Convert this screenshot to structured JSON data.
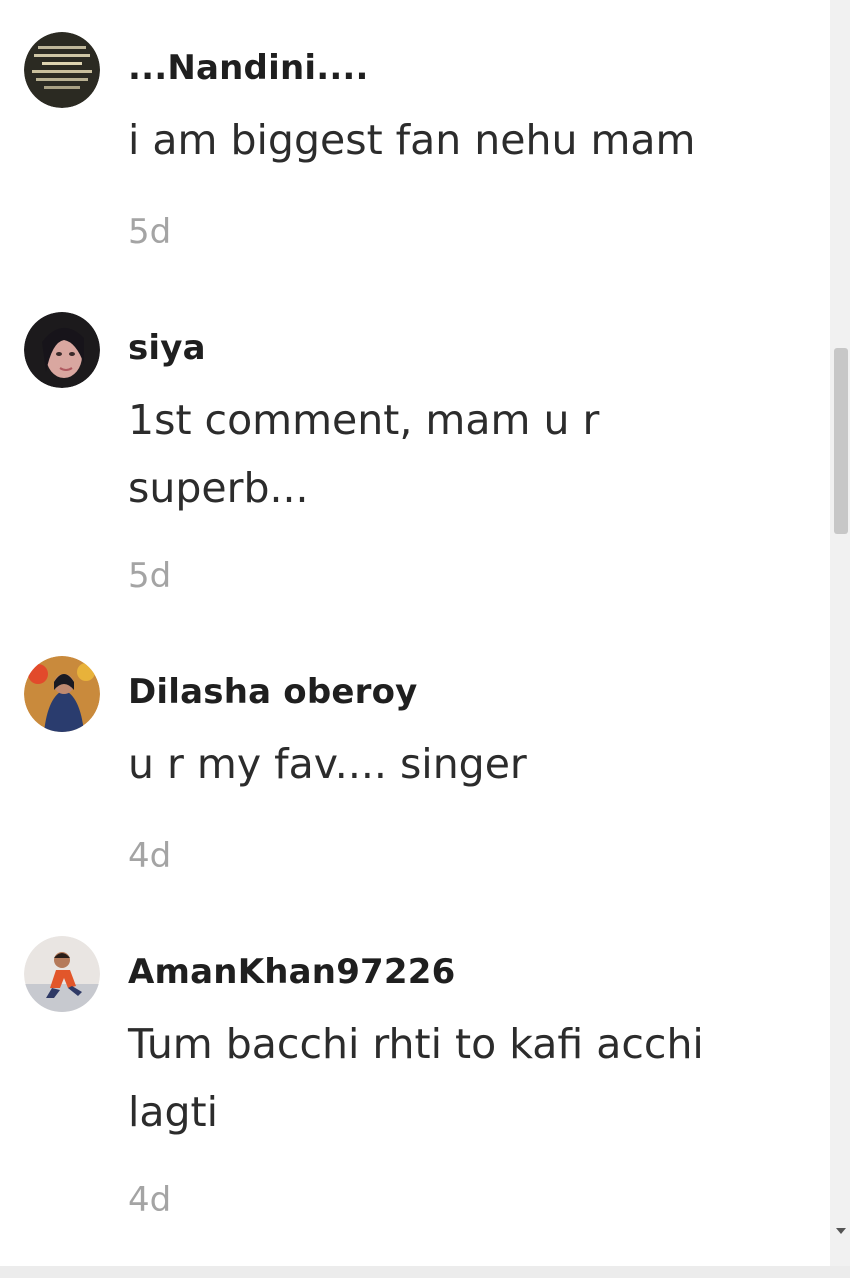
{
  "comments": [
    {
      "username": "...Nandini....",
      "text": "i am biggest fan nehu mam",
      "time": "5d",
      "avatar": "avatar-nandini"
    },
    {
      "username": "siya",
      "text": "1st comment, mam u r superb...",
      "time": "5d",
      "avatar": "avatar-siya"
    },
    {
      "username": "Dilasha oberoy",
      "text": "u r my fav.... singer",
      "time": "4d",
      "avatar": "avatar-dilasha"
    },
    {
      "username": "AmanKhan97226",
      "text": "Tum bacchi rhti to kafi acchi lagti",
      "time": "4d",
      "avatar": "avatar-amankhan"
    }
  ],
  "colors": {
    "username": "#1f1f1f",
    "text": "#2c2c2c",
    "timestamp": "#a4a4a4",
    "scrollbar_thumb": "#c7c7c7"
  }
}
